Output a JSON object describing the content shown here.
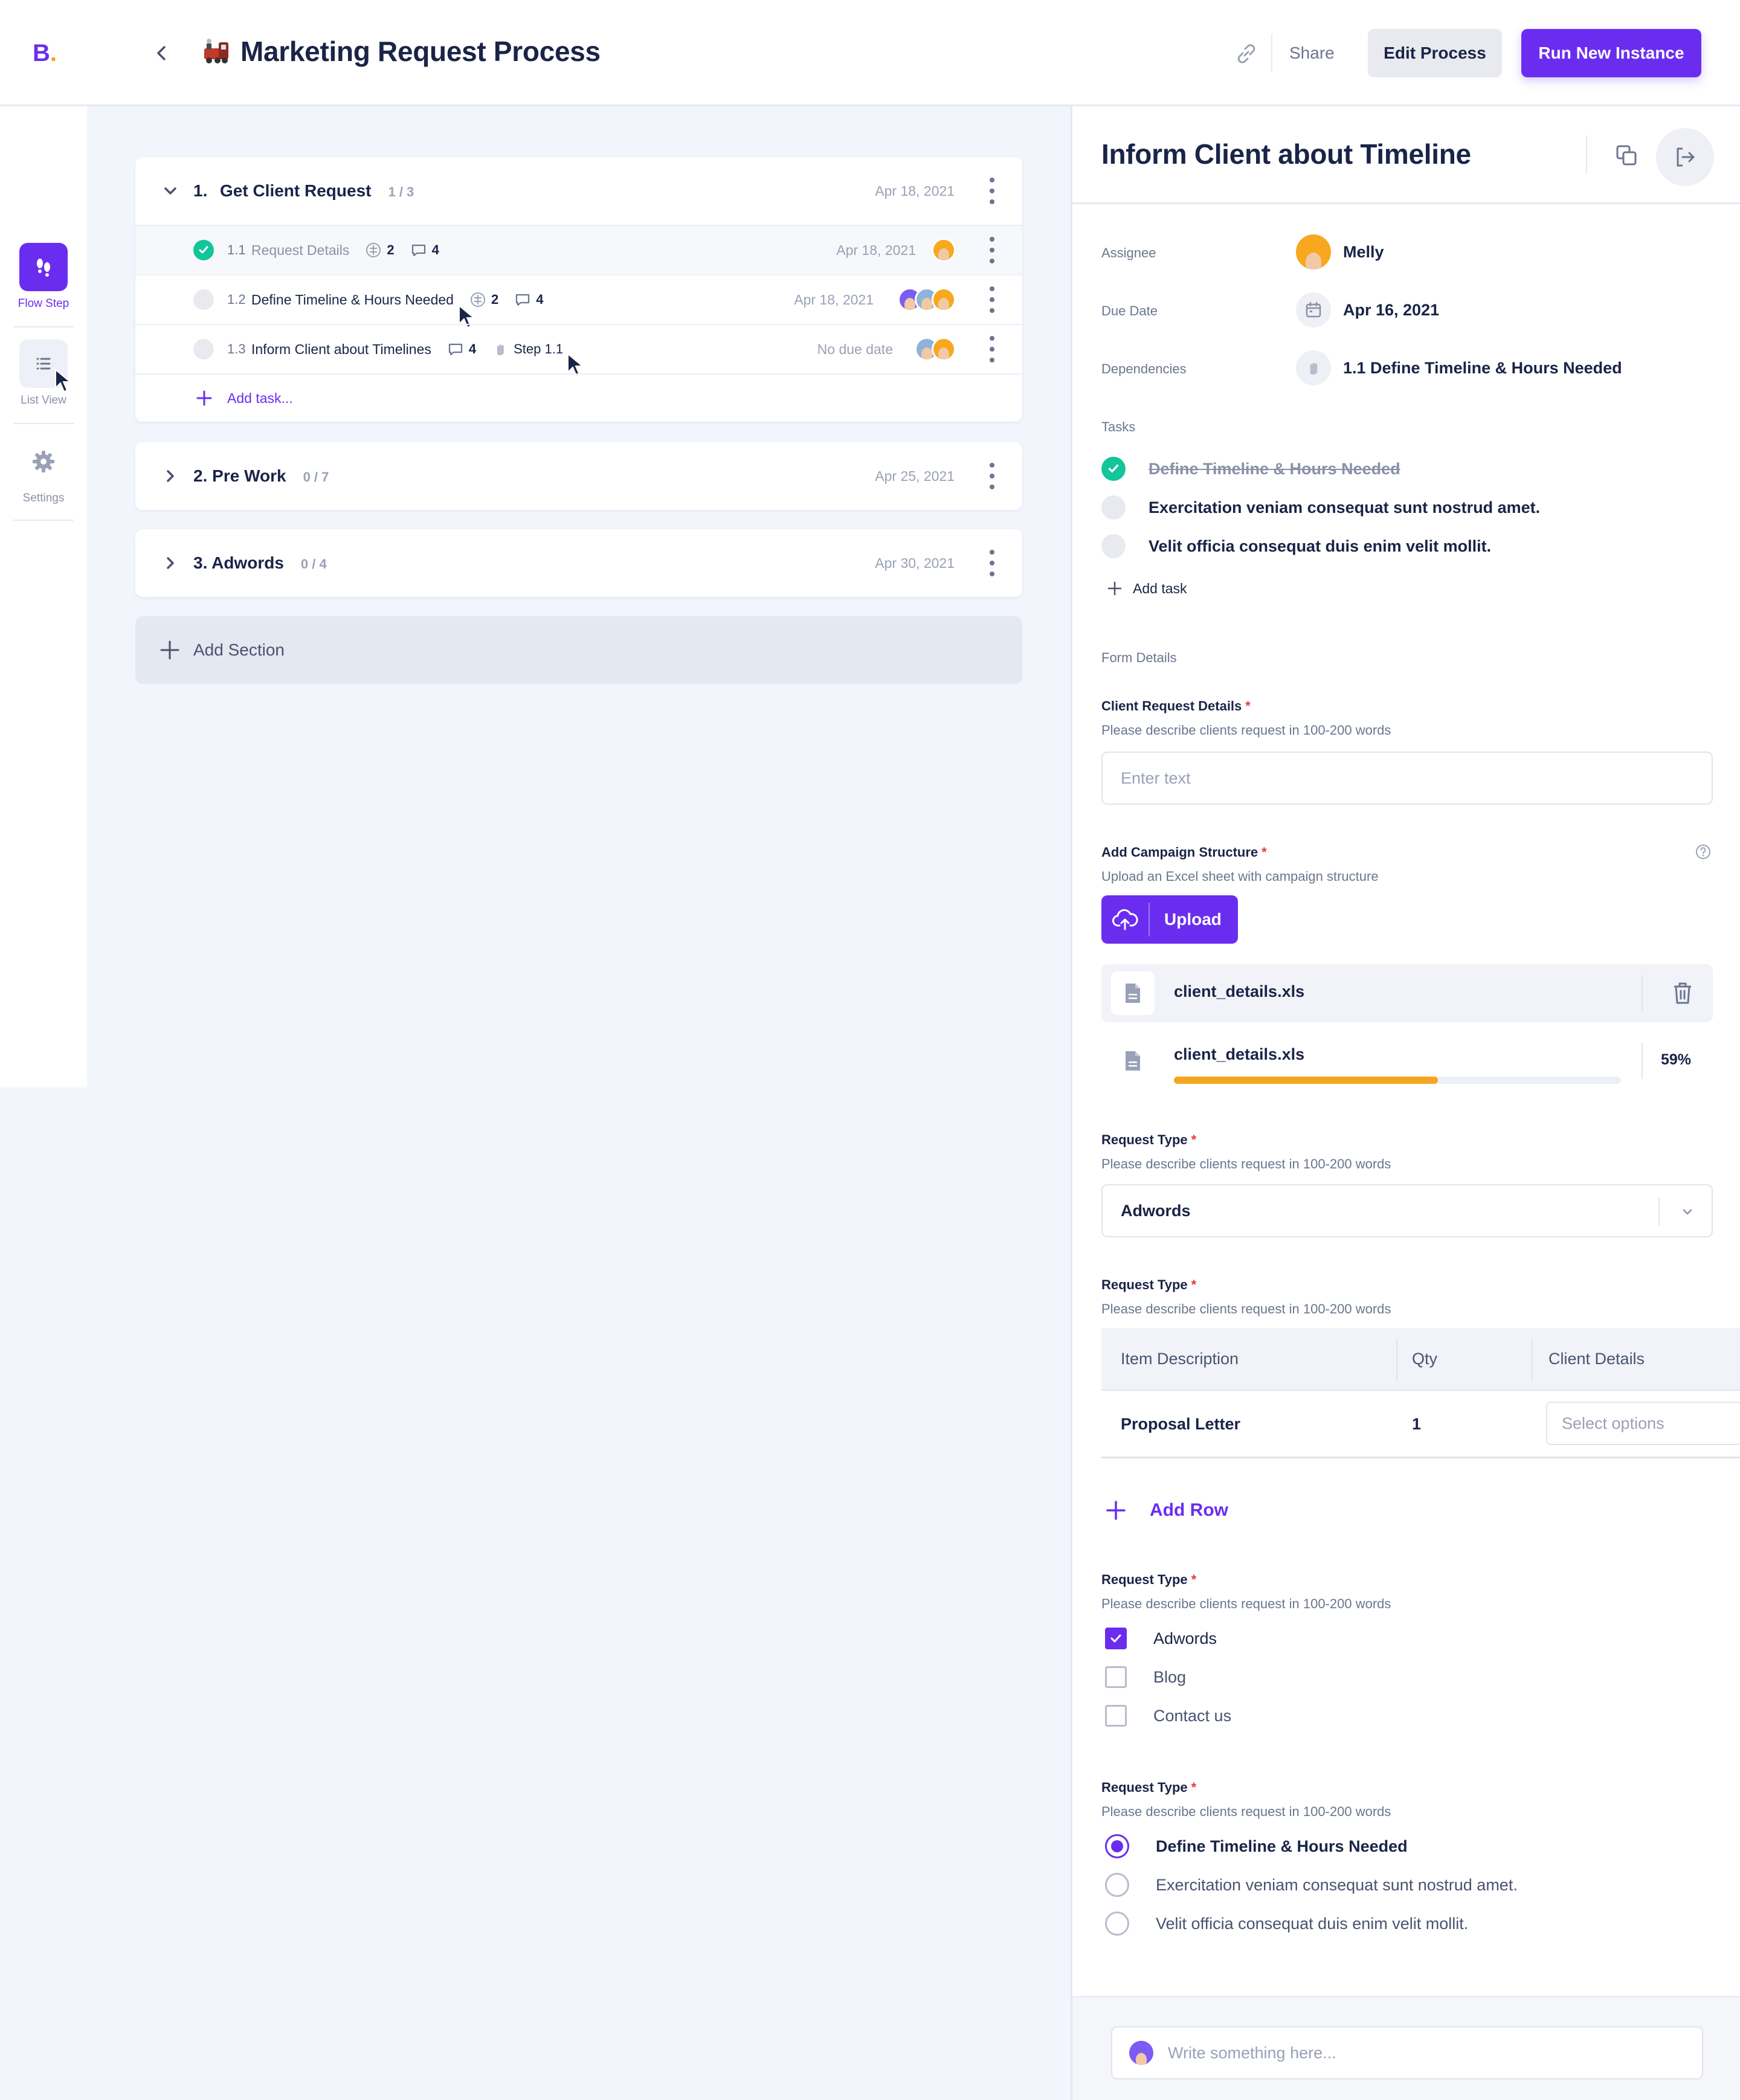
{
  "app": {
    "logo": "B",
    "logo_dot": "."
  },
  "header": {
    "title": "Marketing Request Process",
    "share": "Share",
    "edit": "Edit Process",
    "run": "Run New Instance"
  },
  "rail": {
    "flow": "Flow Step",
    "list": "List View",
    "settings": "Settings"
  },
  "sections": [
    {
      "num": "1.",
      "title": "Get Client Request",
      "count": "1 / 3",
      "date": "Apr 18, 2021",
      "tasks": [
        {
          "num": "1.1",
          "name": "Request Details",
          "subtasks": "2",
          "comments": "4",
          "date": "Apr 18, 2021"
        },
        {
          "num": "1.2",
          "name": "Define Timeline & Hours Needed",
          "subtasks": "2",
          "comments": "4",
          "date": "Apr 18, 2021"
        },
        {
          "num": "1.3",
          "name": "Inform Client about Timelines",
          "comments": "4",
          "dependency": "Step 1.1",
          "date": "No due date"
        }
      ],
      "add_task": "Add task..."
    },
    {
      "num": "2.",
      "title": "Pre Work",
      "count": "0 / 7",
      "date": "Apr 25, 2021"
    },
    {
      "num": "3.",
      "title": "Adwords",
      "count": "0 / 4",
      "date": "Apr 30, 2021"
    }
  ],
  "add_section": "Add Section",
  "panel": {
    "title": "Inform Client about Timeline",
    "assignee_label": "Assignee",
    "assignee": "Melly",
    "due_label": "Due Date",
    "due": "Apr 16, 2021",
    "dep_label": "Dependencies",
    "dep": "1.1 Define Timeline & Hours Needed",
    "tasks_label": "Tasks",
    "tasks": [
      "Define Timeline & Hours Needed",
      "Exercitation veniam consequat sunt nostrud amet.",
      "Velit officia consequat duis enim velit mollit."
    ],
    "add_task": "Add task",
    "form_label": "Form Details",
    "q1": {
      "title": "Client Request Details",
      "req": "*",
      "sub": "Please describe clients request in 100-200 words",
      "placeholder": "Enter text"
    },
    "q2": {
      "title": "Add Campaign Structure",
      "req": "*",
      "sub": "Upload an Excel sheet with campaign structure",
      "upload": "Upload",
      "files": [
        {
          "name": "client_details.xls"
        },
        {
          "name": "client_details.xls",
          "progress": "59%"
        }
      ]
    },
    "q3": {
      "title": "Request Type",
      "req": "*",
      "sub": "Please describe clients request in 100-200 words",
      "value": "Adwords"
    },
    "q4": {
      "title": "Request Type",
      "req": "*",
      "sub": "Please describe clients request in 100-200 words",
      "headers": [
        "Item Description",
        "Qty",
        "Client Details"
      ],
      "rows": [
        {
          "item": "Proposal Letter",
          "qty": "1",
          "placeholder": "Select options"
        }
      ],
      "add_row": "Add Row"
    },
    "q5": {
      "title": "Request Type",
      "req": "*",
      "sub": "Please describe clients request in 100-200 words",
      "options": [
        "Adwords",
        "Blog",
        "Contact us"
      ]
    },
    "q6": {
      "title": "Request Type",
      "req": "*",
      "sub": "Please describe clients request in 100-200 words",
      "options": [
        "Define Timeline & Hours Needed",
        "Exercitation veniam consequat sunt nostrud amet.",
        "Velit officia consequat duis enim velit mollit."
      ]
    },
    "comment_placeholder": "Write something here..."
  },
  "colors": {
    "accent": "#6a2df0",
    "success": "#13c59a",
    "progress": "#f5a520",
    "required": "#e53b3b"
  }
}
